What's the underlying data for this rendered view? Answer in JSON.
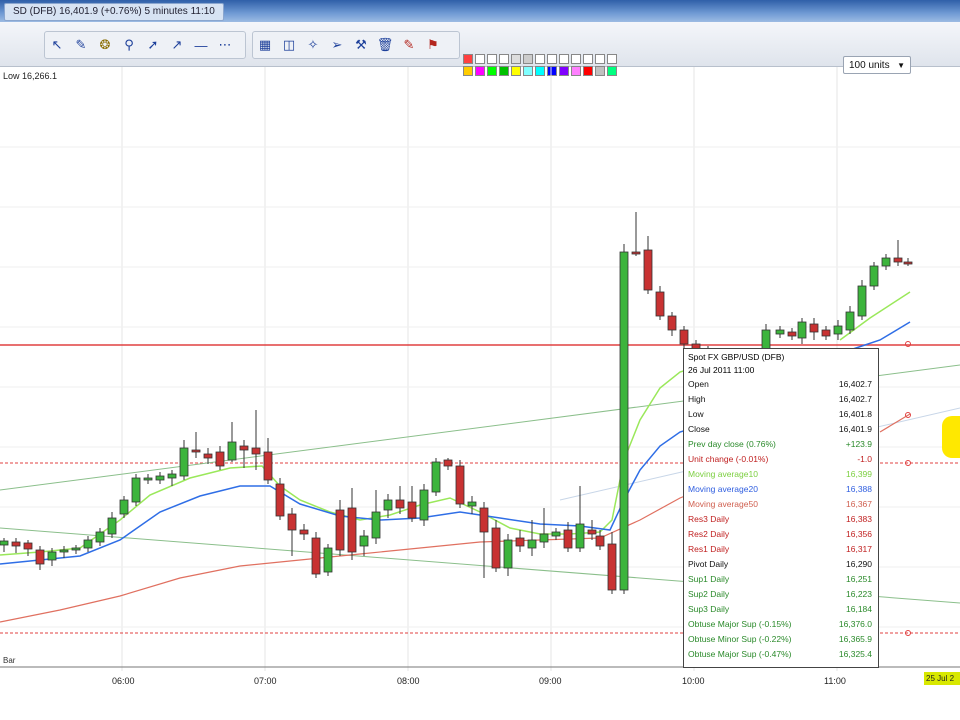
{
  "window": {
    "title_tab": "SD (DFB)   16,401.9 (+0.76%)   5 minutes 11:10"
  },
  "toolbar": {
    "tools": [
      "pointer-icon",
      "pencil-icon",
      "crosshair-icon",
      "zoom-icon",
      "line-icon",
      "ray-icon",
      "horizontal-line-icon",
      "fib-icon",
      "channel-icon",
      "gann-icon",
      "arrow-icon",
      "pitchfork-icon",
      "delete-icon",
      "text-icon",
      "flag-icon"
    ],
    "swatch_colors": [
      "#ff4040",
      "#ffffff",
      "#ffffff",
      "#ffffff",
      "#dddddd",
      "#cccccc",
      "#ffffff",
      "#ffffff",
      "#ffffff",
      "#ffffff",
      "#ffffff",
      "#ffffff",
      "#ffffff",
      "#ffcc00",
      "#ff00ff",
      "#00ff00",
      "#00c000",
      "#ffff00",
      "#80ffff",
      "#00ffff",
      "#0000ff",
      "#8000ff",
      "#ff80ff",
      "#ff0000",
      "#c0c0c0",
      "#00ff80"
    ],
    "units_value": "100 units"
  },
  "chart": {
    "low_label": "Low 16,266.1",
    "x_labels": [
      "06:00",
      "07:00",
      "08:00",
      "09:00",
      "10:00",
      "11:00"
    ],
    "edge_tag": "25 Jul 2",
    "bottom_fragment": "Bar",
    "colors": {
      "up": "#3cb43c",
      "down": "#c83232",
      "ema_fast": "#9ae85a",
      "ema_mid": "#2f6ee6",
      "ema_slow": "#e07060",
      "grid": "#e6e6e6",
      "pivot_red": "#e04040",
      "trend_green": "#8bbf8b"
    },
    "current_value_label": "16,401"
  },
  "chart_data": {
    "type": "candlestick",
    "instrument": "Spot FX GBP/USD (DFB)",
    "interval": "5 minutes",
    "x": [
      "06:00",
      "07:00",
      "08:00",
      "09:00",
      "10:00",
      "11:00"
    ]
  },
  "popup": {
    "header": "Spot FX GBP/USD (DFB)",
    "date": "26 Jul 2011 11:00",
    "rows": [
      {
        "label": "Open",
        "value": "16,402.7",
        "color": "#111111"
      },
      {
        "label": "High",
        "value": "16,402.7",
        "color": "#111111"
      },
      {
        "label": "Low",
        "value": "16,401.8",
        "color": "#111111"
      },
      {
        "label": "Close",
        "value": "16,401.9",
        "color": "#111111"
      },
      {
        "label": "Prev day close (0.76%)",
        "value": "+123.9",
        "color": "#2a8a2a"
      },
      {
        "label": "Unit change (-0.01%)",
        "value": "-1.0",
        "color": "#c02020"
      },
      {
        "label": "Moving average10",
        "value": "16,399",
        "color": "#7ccf40"
      },
      {
        "label": "Moving average20",
        "value": "16,388",
        "color": "#2f5ee0"
      },
      {
        "label": "Moving average50",
        "value": "16,367",
        "color": "#d06050"
      },
      {
        "label": "Res3 Daily",
        "value": "16,383",
        "color": "#c02020"
      },
      {
        "label": "Res2 Daily",
        "value": "16,356",
        "color": "#c02020"
      },
      {
        "label": "Res1 Daily",
        "value": "16,317",
        "color": "#c02020"
      },
      {
        "label": "Pivot Daily",
        "value": "16,290",
        "color": "#111111"
      },
      {
        "label": "Sup1 Daily",
        "value": "16,251",
        "color": "#2a8a2a"
      },
      {
        "label": "Sup2 Daily",
        "value": "16,223",
        "color": "#2a8a2a"
      },
      {
        "label": "Sup3 Daily",
        "value": "16,184",
        "color": "#2a8a2a"
      },
      {
        "label": "Obtuse Major Sup (-0.15%)",
        "value": "16,376.0",
        "color": "#2a8a2a"
      },
      {
        "label": "Obtuse Minor Sup (-0.22%)",
        "value": "16,365.9",
        "color": "#2a8a2a"
      },
      {
        "label": "Obtuse Major Sup (-0.47%)",
        "value": "16,325.4",
        "color": "#2a8a2a"
      }
    ]
  }
}
